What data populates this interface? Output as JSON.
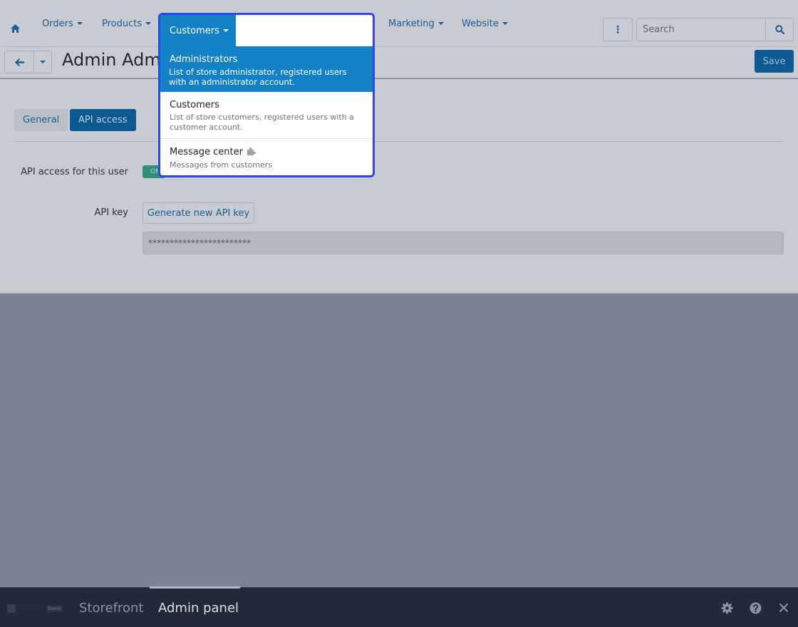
{
  "nav": {
    "items": [
      {
        "label": "Orders"
      },
      {
        "label": "Products"
      },
      {
        "label": "Marketing"
      },
      {
        "label": "Website"
      }
    ],
    "search_placeholder": "Search"
  },
  "titlebar": {
    "title": "Admin Admi",
    "save_label": "Save"
  },
  "tabs": [
    {
      "label": "General"
    },
    {
      "label": "API access"
    }
  ],
  "form": {
    "api_access_label": "API access for this user",
    "toggle_text": "ON",
    "api_key_label": "API key",
    "generate_button": "Generate new API key",
    "api_key_value": "************************"
  },
  "dropdown": {
    "header": "Customers",
    "items": [
      {
        "title": "Administrators",
        "description": "List of store administrator, registered users with an administrator account."
      },
      {
        "title": "Customers",
        "description": "List of store customers, registered users with a customer account."
      },
      {
        "title": "Message center",
        "description": "Messages from customers"
      }
    ]
  },
  "bottombar": {
    "logo_text": "cs-cart",
    "logo_badge": "Demo",
    "tabs": [
      {
        "label": "Storefront"
      },
      {
        "label": "Admin panel"
      }
    ]
  },
  "colors": {
    "accent": "#1281c6",
    "dropdown_outline": "#2b49e6",
    "toggle_on": "#2f8f7a"
  }
}
